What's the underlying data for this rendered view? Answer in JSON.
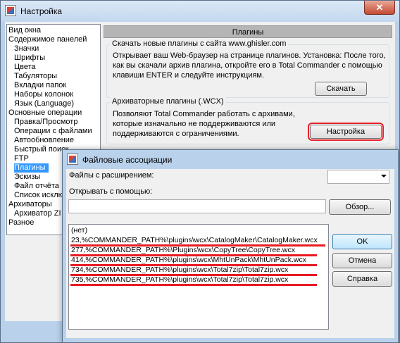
{
  "window": {
    "title": "Настройка",
    "close_glyph": "✕",
    "tree_items": [
      {
        "label": "Вид окна",
        "indent": 0
      },
      {
        "label": "Содержимое панелей",
        "indent": 0
      },
      {
        "label": "Значки",
        "indent": 1
      },
      {
        "label": "Шрифты",
        "indent": 1
      },
      {
        "label": "Цвета",
        "indent": 1
      },
      {
        "label": "Табуляторы",
        "indent": 1
      },
      {
        "label": "Вкладки папок",
        "indent": 1
      },
      {
        "label": "Наборы колонок",
        "indent": 1
      },
      {
        "label": "Язык (Language)",
        "indent": 1
      },
      {
        "label": "Основные операции",
        "indent": 0
      },
      {
        "label": "Правка/Просмотр",
        "indent": 1
      },
      {
        "label": "Операции с файлами",
        "indent": 1
      },
      {
        "label": "Автообновление",
        "indent": 1
      },
      {
        "label": "Быстрый поиск",
        "indent": 1
      },
      {
        "label": "FTP",
        "indent": 1
      },
      {
        "label": "Плагины",
        "indent": 1,
        "selected": true
      },
      {
        "label": "Эскизы",
        "indent": 1
      },
      {
        "label": "Файл отчёта",
        "indent": 1
      },
      {
        "label": "Список исклю",
        "indent": 1
      },
      {
        "label": "Архиваторы",
        "indent": 0
      },
      {
        "label": "Архиватор ZI",
        "indent": 1
      },
      {
        "label": "Разное",
        "indent": 0
      }
    ],
    "panel_title": "Плагины",
    "download_group": {
      "legend": "Скачать новые плагины с сайта www.ghisler.com",
      "description": "Открывает ваш Web-браузер на странице плагинов. Установка: После того, как вы скачали архив плагина, откройте его в Total Commander с помощью клавиши ENTER и следуйте инструкциям.",
      "button_label": "Скачать"
    },
    "archiver_group": {
      "legend": "Архиваторные плагины (.WCX)",
      "description": "Позволяют Total Commander работать с архивами, которые изначально не поддерживаются или поддерживаются с ограничениями.",
      "button_label": "Настройка"
    }
  },
  "dialog": {
    "title": "Файловые ассоциации",
    "extensions_label": "Файлы с расширением:",
    "extension_value": "",
    "open_with_label": "Открывать с помощью:",
    "open_with_value": "",
    "browse_label": "Обзор...",
    "list_items": [
      "(нет)",
      "23,%COMMANDER_PATH%\\plugins\\wcx\\CatalogMaker\\CatalogMaker.wcx",
      "277,%COMMANDER_PATH%\\Plugins\\wcx\\CopyTree\\CopyTree.wcx",
      "414,%COMMANDER_PATH%\\plugins\\wcx\\MhtUnPack\\MhtUnPack.wcx",
      "734,%COMMANDER_PATH%\\plugins\\wcx\\Total7zip\\Total7zip.wcx",
      "735,%COMMANDER_PATH%\\plugins\\wcx\\Total7zip\\Total7zip.wcx"
    ],
    "ok_label": "OK",
    "cancel_label": "Отмена",
    "help_label": "Справка"
  },
  "colors": {
    "highlight_red": "#e81a22",
    "selection_blue": "#3399ff"
  }
}
